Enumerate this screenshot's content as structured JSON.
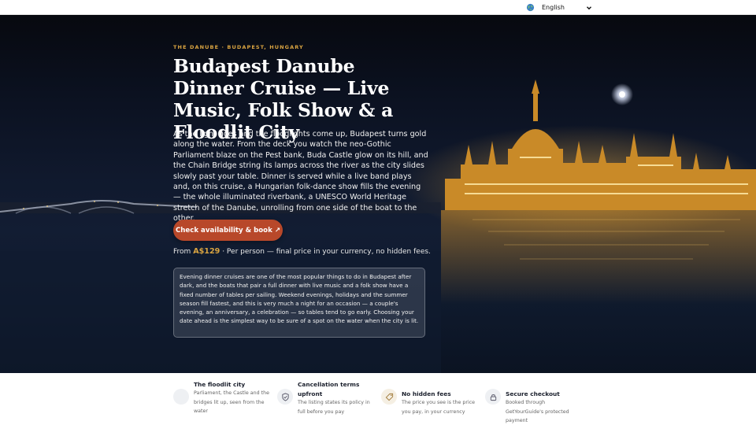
{
  "language": {
    "selected": "English",
    "icon": "globe-icon"
  },
  "hero": {
    "eyebrow": "THE DANUBE · BUDAPEST, HUNGARY",
    "title": "Budapest Danube Dinner Cruise — Live Music, Folk Show & a Floodlit City",
    "lead": "As the light goes and the floodlights come up, Budapest turns gold along the water. From the deck you watch the neo-Gothic Parliament blaze on the Pest bank, Buda Castle glow on its hill, and the Chain Bridge string its lamps across the river as the city slides slowly past your table. Dinner is served while a live band plays and, on this cruise, a Hungarian folk-dance show fills the evening — the whole illuminated riverbank, a UNESCO World Heritage stretch of the Danube, unrolling from one side of the boat to the other.",
    "cta_label": "Check availability & book ↗",
    "price_prefix": "From",
    "price_amount": "A$129",
    "price_suffix": "· Per person — final price in your currency, no hidden fees.",
    "note": "Evening dinner cruises are one of the most popular things to do in Budapest after dark, and the boats that pair a full dinner with live music and a folk show have a fixed number of tables per sailing. Weekend evenings, holidays and the summer season fill fastest, and this is very much a night for an occasion — a couple's evening, an anniversary, a celebration — so tables tend to go early. Choosing your date ahead is the simplest way to be sure of a spot on the water when the city is lit."
  },
  "features": [
    {
      "title": "The floodlit city",
      "desc": "Parliament, the Castle and the bridges lit up, seen from the water",
      "icon": "blank-icon"
    },
    {
      "title": "Cancellation terms upfront",
      "desc": "The listing states its policy in full before you pay",
      "icon": "shield-check-icon"
    },
    {
      "title": "No hidden fees",
      "desc": "The price you see is the price you pay, in your currency",
      "icon": "tag-icon"
    },
    {
      "title": "Secure checkout",
      "desc": "Booked through GetYourGuide's protected payment",
      "icon": "lock-icon"
    }
  ],
  "colors": {
    "accent": "#d9a441",
    "cta": "#b8482a",
    "hero_bg": "#0f1829"
  }
}
